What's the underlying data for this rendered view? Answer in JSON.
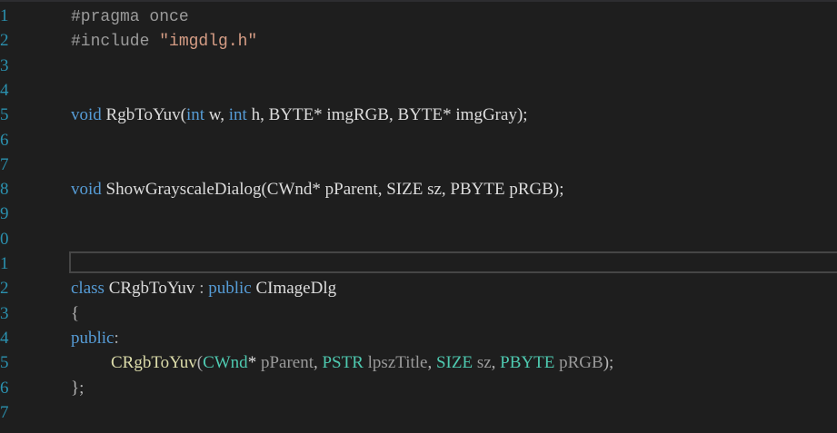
{
  "editor": {
    "line_numbers": [
      "1",
      "2",
      "3",
      "4",
      "5",
      "6",
      "7",
      "8",
      "9",
      "0",
      "1",
      "2",
      "3",
      "4",
      "5",
      "6",
      "7"
    ],
    "lines": [
      {
        "tokens": [
          {
            "t": "#pragma once",
            "c": "pp",
            "m": 1
          }
        ]
      },
      {
        "tokens": [
          {
            "t": "#include ",
            "c": "pp",
            "m": 1
          },
          {
            "t": "\"imgdlg.h\"",
            "c": "str",
            "m": 1
          }
        ]
      },
      {
        "tokens": []
      },
      {
        "tokens": []
      },
      {
        "tokens": [
          {
            "t": "void",
            "c": "kw"
          },
          {
            "t": " RgbToYuv(",
            "c": "plain"
          },
          {
            "t": "int",
            "c": "kw"
          },
          {
            "t": " w, ",
            "c": "plain"
          },
          {
            "t": "int",
            "c": "kw"
          },
          {
            "t": " h, BYTE* imgRGB, BYTE* imgGray);",
            "c": "plain"
          }
        ]
      },
      {
        "tokens": []
      },
      {
        "tokens": []
      },
      {
        "tokens": [
          {
            "t": "void",
            "c": "kw"
          },
          {
            "t": " ShowGrayscaleDialog(CWnd* pParent, SIZE sz, PBYTE pRGB);",
            "c": "plain"
          }
        ]
      },
      {
        "tokens": []
      },
      {
        "tokens": []
      },
      {
        "tokens": []
      },
      {
        "tokens": [
          {
            "t": "class",
            "c": "kw"
          },
          {
            "t": " CRgbToYuv ",
            "c": "plain"
          },
          {
            "t": ":",
            "c": "punct"
          },
          {
            "t": " ",
            "c": "plain"
          },
          {
            "t": "public",
            "c": "kw"
          },
          {
            "t": " CImageDlg",
            "c": "plain"
          }
        ]
      },
      {
        "tokens": [
          {
            "t": "{",
            "c": "punct"
          }
        ]
      },
      {
        "tokens": [
          {
            "t": "public",
            "c": "kw"
          },
          {
            "t": ":",
            "c": "punct"
          }
        ]
      },
      {
        "indent": true,
        "tokens": [
          {
            "t": "CRgbToYuv",
            "c": "fn"
          },
          {
            "t": "(",
            "c": "punct"
          },
          {
            "t": "CWnd",
            "c": "type"
          },
          {
            "t": "* ",
            "c": "plain"
          },
          {
            "t": "pParent",
            "c": "param"
          },
          {
            "t": ", ",
            "c": "punct"
          },
          {
            "t": "PSTR",
            "c": "type"
          },
          {
            "t": " ",
            "c": "plain"
          },
          {
            "t": "lpszTitle",
            "c": "param"
          },
          {
            "t": ", ",
            "c": "punct"
          },
          {
            "t": "SIZE",
            "c": "type"
          },
          {
            "t": " ",
            "c": "plain"
          },
          {
            "t": "sz",
            "c": "param"
          },
          {
            "t": ", ",
            "c": "punct"
          },
          {
            "t": "PBYTE",
            "c": "type"
          },
          {
            "t": " ",
            "c": "plain"
          },
          {
            "t": "pRGB",
            "c": "param"
          },
          {
            "t": ");",
            "c": "punct"
          }
        ]
      },
      {
        "tokens": [
          {
            "t": "};",
            "c": "punct"
          }
        ]
      },
      {
        "tokens": []
      }
    ]
  },
  "colors": {
    "background": "#1e1e1e",
    "line_number": "#2b91af",
    "keyword": "#569cd6",
    "preprocessor": "#9b9b9b",
    "string": "#d69d85",
    "function": "#dcdcaa",
    "type": "#4ec9b0",
    "parameter": "#9a9a9a",
    "text": "#dcdcdc"
  }
}
